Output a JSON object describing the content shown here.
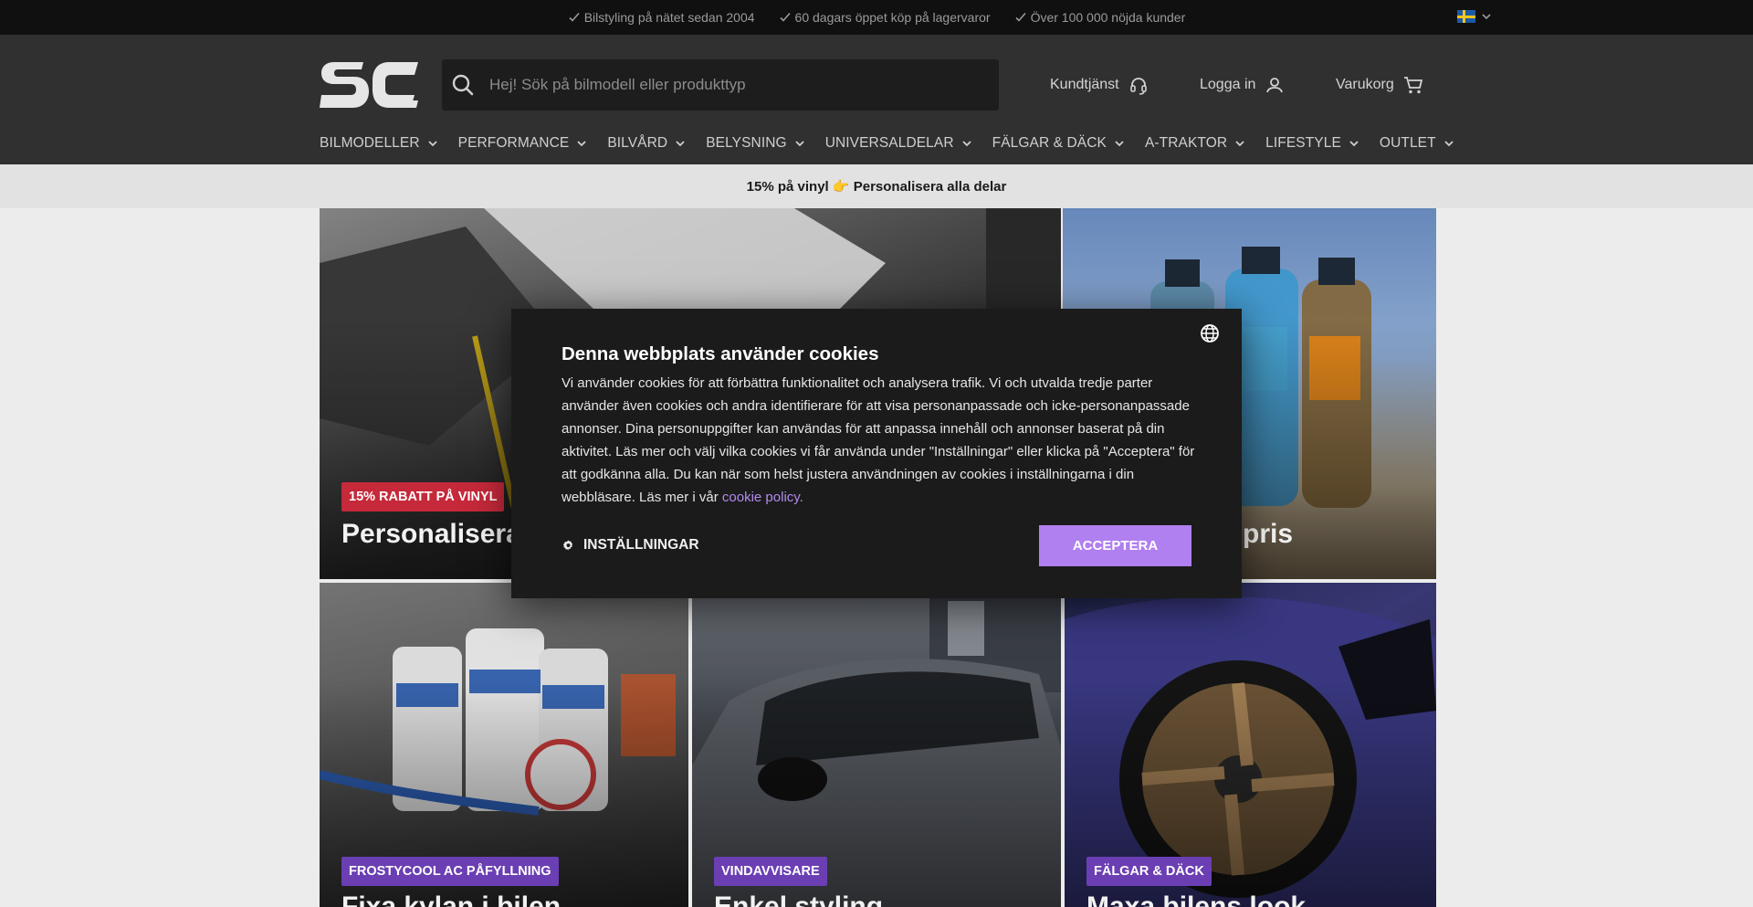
{
  "topbar": {
    "usps": [
      "Bilstyling på nätet sedan 2004",
      "60 dagars öppet köp på lagervaror",
      "Över 100 000 nöjda kunder"
    ],
    "language_flag": "sweden-flag-icon"
  },
  "header": {
    "logo_text": "SC",
    "search_placeholder": "Hej! Sök på bilmodell eller produkttyp",
    "customer_service_label": "Kundtjänst",
    "login_label": "Logga in",
    "cart_label": "Varukorg"
  },
  "nav": {
    "items": [
      "BILMODELLER",
      "PERFORMANCE",
      "BILVÅRD",
      "BELYSNING",
      "UNIVERSALDELAR",
      "FÄLGAR & DÄCK",
      "A-TRAKTOR",
      "LIFESTYLE",
      "OUTLET"
    ]
  },
  "promo": {
    "text": "15% på vinyl 👉 Personalisera alla delar"
  },
  "tiles": [
    {
      "badge": "15% RABATT PÅ VINYL",
      "title": "Personalisera",
      "badge_color": "#c5293a"
    },
    {
      "badge": "",
      "title": "d till bra pris",
      "badge_color": ""
    },
    {
      "badge": "FROSTYCOOL AC PÅFYLLNING",
      "title": "Fixa kylan i bilen",
      "badge_color": "#6b3fb3"
    },
    {
      "badge": "VINDAVVISARE",
      "title": "Enkel styling",
      "badge_color": "#6b3fb3"
    },
    {
      "badge": "FÄLGAR & DÄCK",
      "title": "Maxa bilens look",
      "badge_color": "#6b3fb3"
    }
  ],
  "cookie": {
    "title": "Denna webbplats använder cookies",
    "body": "Vi använder cookies för att förbättra funktionalitet och analysera trafik. Vi och utvalda tredje parter använder även cookies och andra identifierare för att visa personanpassade och icke-personanpassade annonser. Dina personuppgifter kan användas för att anpassa innehåll och annonser baserat på din aktivitet. Läs mer och välj vilka cookies vi får använda under \"Inställningar\" eller klicka på \"Acceptera\" för att godkänna alla. Du kan när som helst justera användningen av cookies i inställningarna i din webbläsare. Läs mer i vår ",
    "policy_link": "cookie policy.",
    "settings_label": "INSTÄLLNINGAR",
    "accept_label": "ACCEPTERA"
  },
  "colors": {
    "accent": "#b07ff0",
    "badge_purple": "#6b3fb3",
    "badge_red": "#c5293a",
    "header_bg": "#303030",
    "topbar_bg": "#101010"
  }
}
